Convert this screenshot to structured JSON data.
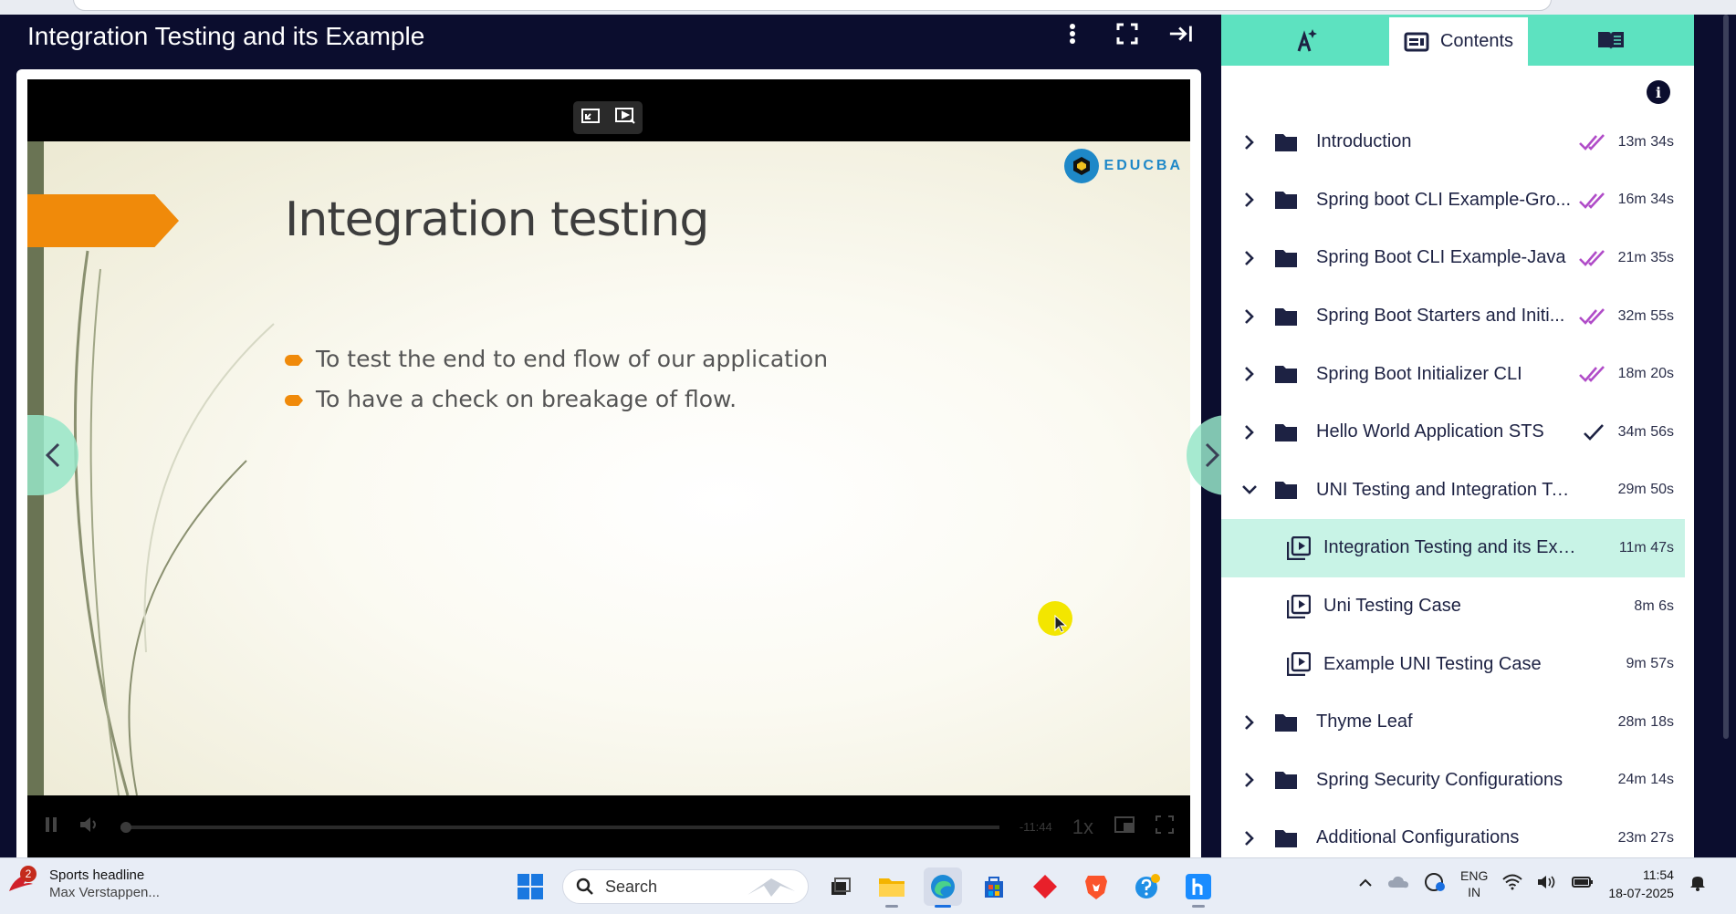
{
  "header": {
    "lesson_title": "Integration Testing and its Example"
  },
  "slide": {
    "heading": "Integration testing",
    "bullets": [
      "To test the end to end flow of our application",
      "To have a check on breakage of flow."
    ],
    "logo_text": "EDUCBA"
  },
  "player": {
    "time_remaining": "-11:44",
    "speed": "1x",
    "progress_fraction": 0.0
  },
  "sidebar": {
    "tabs": [
      {
        "label": "",
        "icon": "ai-sparkle-icon"
      },
      {
        "label": "Contents",
        "icon": "contents-icon"
      },
      {
        "label": "",
        "icon": "notes-book-icon"
      }
    ],
    "items": [
      {
        "type": "folder",
        "name": "Introduction",
        "duration": "13m 34s",
        "status": "completed"
      },
      {
        "type": "folder",
        "name": "Spring boot CLI Example-Gro...",
        "duration": "16m 34s",
        "status": "completed"
      },
      {
        "type": "folder",
        "name": "Spring Boot CLI Example-Java",
        "duration": "21m 35s",
        "status": "completed"
      },
      {
        "type": "folder",
        "name": "Spring Boot Starters and Initi...",
        "duration": "32m 55s",
        "status": "completed"
      },
      {
        "type": "folder",
        "name": "Spring Boot Initializer CLI",
        "duration": "18m 20s",
        "status": "completed"
      },
      {
        "type": "folder",
        "name": "Hello World Application STS",
        "duration": "34m 56s",
        "status": "partial"
      },
      {
        "type": "folder",
        "name": "UNI Testing and Integration Testi...",
        "duration": "29m 50s",
        "status": "open"
      },
      {
        "type": "lesson",
        "name": "Integration Testing and its Exa...",
        "duration": "11m 47s",
        "status": "active"
      },
      {
        "type": "lesson",
        "name": "Uni Testing Case",
        "duration": "8m 6s",
        "status": "none"
      },
      {
        "type": "lesson",
        "name": "Example UNI Testing Case",
        "duration": "9m 57s",
        "status": "none"
      },
      {
        "type": "folder",
        "name": "Thyme Leaf",
        "duration": "28m 18s",
        "status": "none"
      },
      {
        "type": "folder",
        "name": "Spring Security Configurations",
        "duration": "24m 14s",
        "status": "none"
      },
      {
        "type": "folder",
        "name": "Additional Configurations",
        "duration": "23m 27s",
        "status": "none"
      }
    ]
  },
  "taskbar": {
    "news_title": "Sports headline",
    "news_sub": "Max Verstappen...",
    "news_badge": "2",
    "search_label": "Search",
    "lang_top": "ENG",
    "lang_bottom": "IN",
    "time": "11:54",
    "date": "18-07-2025"
  },
  "colors": {
    "accent": "#5de2c0",
    "active_row": "#c8f3e6",
    "check_purple": "#b04cc8",
    "dark_bg": "#0b0d2e",
    "slide_orange": "#f08a0a"
  }
}
